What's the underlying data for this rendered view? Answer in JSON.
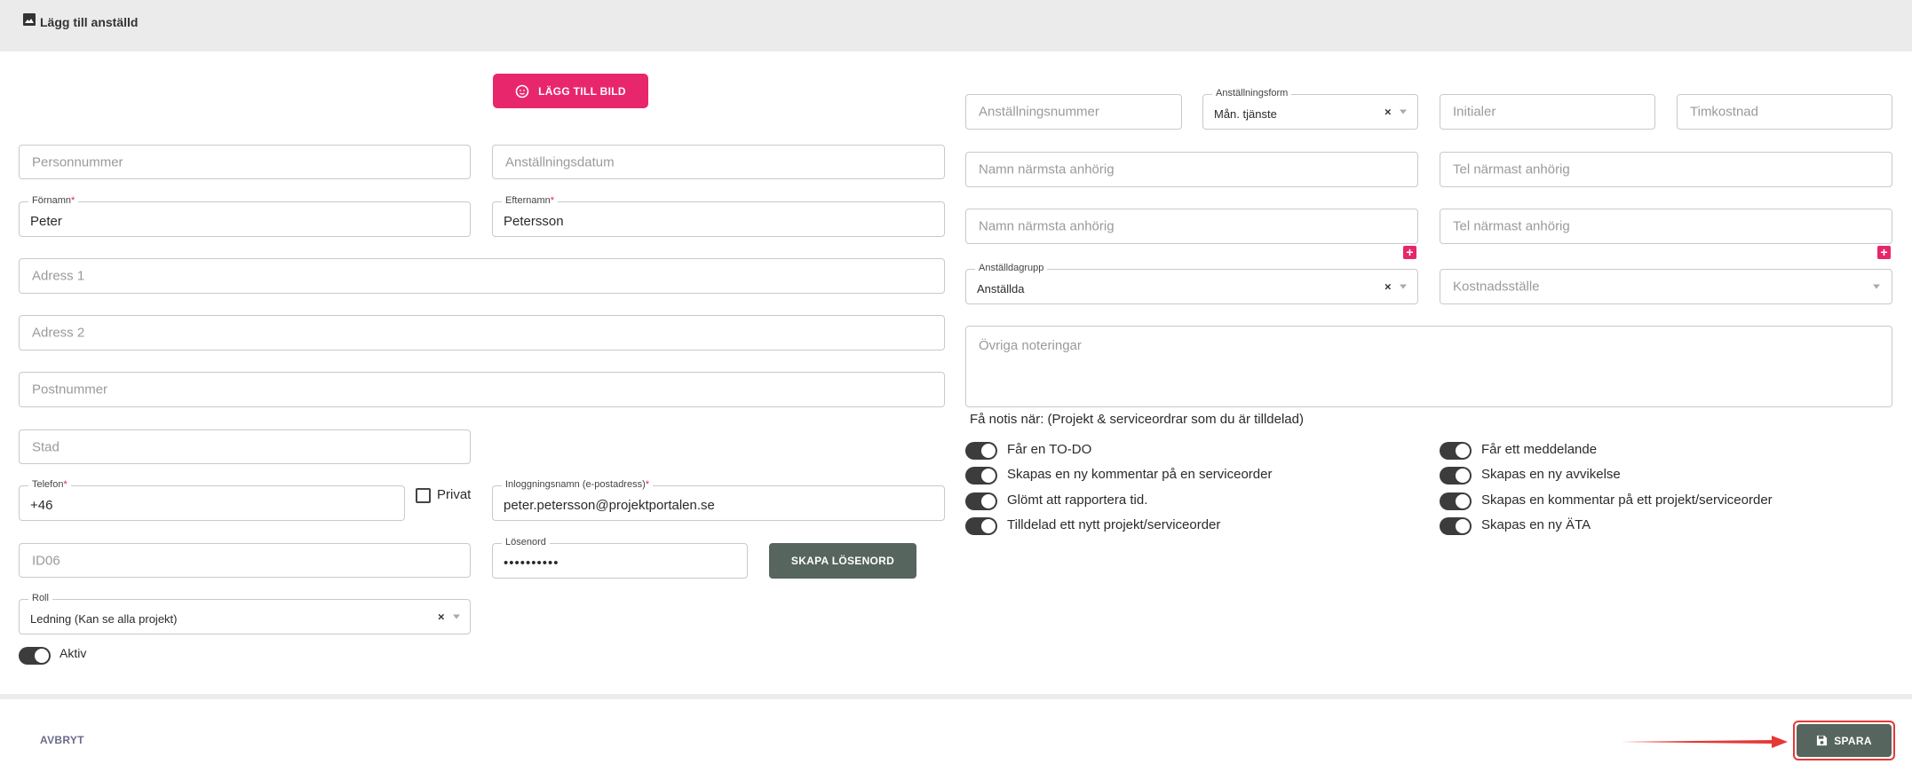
{
  "header": {
    "title": "Lägg till anställd",
    "icon": "image-icon"
  },
  "left": {
    "add_photo_label": "LÄGG TILL BILD",
    "personnummer_placeholder": "Personnummer",
    "anstallningsdatum_placeholder": "Anställningsdatum",
    "fornamn_label": "Förnamn",
    "fornamn_value": "Peter",
    "efternamn_label": "Efternamn",
    "efternamn_value": "Petersson",
    "adress1_placeholder": "Adress 1",
    "adress2_placeholder": "Adress 2",
    "postnummer_placeholder": "Postnummer",
    "stad_placeholder": "Stad",
    "telefon_label": "Telefon",
    "telefon_value": "+46",
    "privat_label": "Privat",
    "login_label": "Inloggningsnamn (e-postadress)",
    "login_value": "peter.petersson@projektportalen.se",
    "id06_placeholder": "ID06",
    "losenord_label": "Lösenord",
    "losenord_value": "••••••••••",
    "create_password_label": "SKAPA LÖSENORD",
    "roll_label": "Roll",
    "roll_value": "Ledning (Kan se alla projekt)",
    "aktiv_label": "Aktiv",
    "required_mark": "*",
    "clear_mark": "×"
  },
  "right": {
    "anstallningsnummer_placeholder": "Anställningsnummer",
    "anstallningsform_label": "Anställningsform",
    "anstallningsform_value": "Mån. tjänste",
    "initialer_placeholder": "Initialer",
    "timkostnad_placeholder": "Timkostnad",
    "namn_anhorig_placeholder": "Namn närmsta anhörig",
    "tel_anhorig_placeholder": "Tel närmast anhörig",
    "anstalldagrupp_label": "Anställdagrupp",
    "anstalldagrupp_value": "Anställda",
    "kostnadsstalle_placeholder": "Kostnadsställe",
    "notes_placeholder": "Övriga noteringar",
    "notify_heading": "Få notis när: (Projekt & serviceordrar som du är tilldelad)",
    "notify_left": [
      "Får en TO-DO",
      "Skapas en ny kommentar på en serviceorder",
      "Glömt att rapportera tid.",
      "Tilldelad ett nytt projekt/serviceorder"
    ],
    "notify_right": [
      "Får ett meddelande",
      "Skapas en ny avvikelse",
      "Skapas en kommentar på ett projekt/serviceorder",
      "Skapas en ny ÄTA"
    ],
    "plus_mark": "+"
  },
  "footer": {
    "cancel_label": "AVBRYT",
    "save_label": "SPARA"
  },
  "colors": {
    "accent_pink": "#e8266c",
    "dark_button": "#56655e",
    "annotation_red": "#e53935"
  }
}
